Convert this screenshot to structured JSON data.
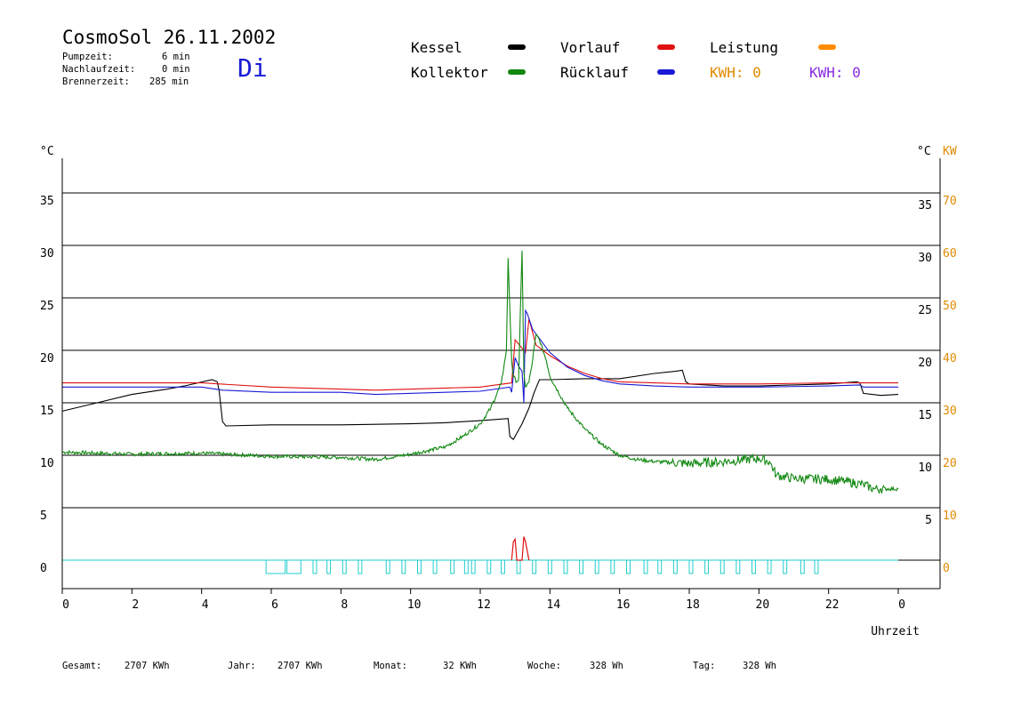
{
  "header": {
    "title": "CosmoSol 26.11.2002",
    "pumpzeit_label": "Pumpzeit:",
    "pumpzeit_value": "6 min",
    "nachlauf_label": "Nachlaufzeit:",
    "nachlauf_value": "0 min",
    "brenner_label": "Brennerzeit:",
    "brenner_value": "285 min",
    "day": "Di"
  },
  "legend": {
    "kessel": {
      "label": "Kessel",
      "color": "#000000"
    },
    "vorlauf": {
      "label": "Vorlauf",
      "color": "#e01010"
    },
    "leistung": {
      "label": "Leistung",
      "color": "#ff8c00"
    },
    "kollektor": {
      "label": "Kollektor",
      "color": "#118811"
    },
    "ruecklauf": {
      "label": "Rücklauf",
      "color": "#1a1ad6"
    },
    "kwh1": {
      "label": "KWH: 0",
      "color": "#e08a00"
    },
    "kwh2": {
      "label": "KWH: 0",
      "color": "#8a2be2"
    }
  },
  "footer": {
    "gesamt_label": "Gesamt:",
    "gesamt_value": "2707 KWh",
    "jahr_label": "Jahr:",
    "jahr_value": "2707 KWh",
    "monat_label": "Monat:",
    "monat_value": "32 KWh",
    "woche_label": "Woche:",
    "woche_value": "328 Wh",
    "tag_label": "Tag:",
    "tag_value": "328 Wh"
  },
  "chart_data": {
    "type": "line",
    "xlabel": "Uhrzeit",
    "ylabel_left": "°C",
    "ylabel_right_c": "°C",
    "ylabel_right_kw": "KW",
    "x_ticks": [
      "0",
      "2",
      "4",
      "6",
      "8",
      "10",
      "12",
      "14",
      "16",
      "18",
      "20",
      "22",
      "0"
    ],
    "y_ticks": [
      0,
      5,
      10,
      15,
      20,
      25,
      30,
      35
    ],
    "y_ticks_kw": [
      0,
      10,
      20,
      30,
      40,
      50,
      60,
      70
    ],
    "xlim": [
      0,
      24
    ],
    "ylim": [
      -2.7,
      38.5
    ],
    "grid": "horizontal",
    "series": [
      {
        "name": "Kessel",
        "color": "#000000",
        "x": [
          0,
          1,
          2,
          3,
          3.5,
          4.3,
          4.45,
          4.5,
          4.6,
          4.7,
          6,
          8,
          10,
          11,
          12,
          12.8,
          12.85,
          12.95,
          13.2,
          13.4,
          13.55,
          13.7,
          14,
          15,
          16,
          17,
          17.6,
          17.8,
          17.9,
          18,
          19,
          20,
          21,
          22,
          22.8,
          22.9,
          23,
          23.5,
          24
        ],
        "y": [
          14.2,
          15.0,
          15.8,
          16.3,
          16.6,
          17.2,
          17.0,
          16.2,
          13.2,
          12.8,
          12.9,
          12.9,
          13.0,
          13.1,
          13.3,
          13.5,
          11.8,
          11.5,
          13.0,
          14.5,
          16.0,
          17.2,
          17.2,
          17.3,
          17.3,
          17.8,
          18.0,
          18.1,
          17.0,
          16.8,
          16.6,
          16.6,
          16.7,
          16.8,
          17.0,
          16.9,
          15.9,
          15.7,
          15.8
        ]
      },
      {
        "name": "Vorlauf",
        "color": "#e01010",
        "x": [
          0,
          4,
          6,
          9,
          12,
          12.9,
          13.0,
          13.3,
          13.4,
          13.6,
          14,
          14.5,
          15,
          15.5,
          16,
          17,
          18,
          20,
          22,
          24
        ],
        "y": [
          16.9,
          16.9,
          16.5,
          16.2,
          16.5,
          16.9,
          21.0,
          19.8,
          23.0,
          20.5,
          19.5,
          18.5,
          17.8,
          17.3,
          17.0,
          16.9,
          16.8,
          16.8,
          16.9,
          16.9
        ],
        "x_wiggle": "none"
      },
      {
        "name": "Rücklauf",
        "color": "#1a1ad6",
        "x": [
          0,
          4,
          4.6,
          6,
          8,
          9,
          12,
          12.85,
          12.9,
          13.0,
          13.1,
          13.2,
          13.25,
          13.3,
          13.35,
          13.5,
          14,
          14.5,
          15,
          15.5,
          16,
          17,
          18,
          20,
          22,
          22.9,
          23,
          24
        ],
        "y": [
          16.5,
          16.5,
          16.2,
          16.0,
          16.0,
          15.8,
          16.1,
          16.5,
          16.0,
          19.3,
          18.5,
          18.0,
          15.0,
          23.8,
          23.5,
          22.0,
          19.8,
          18.4,
          17.6,
          17.1,
          16.8,
          16.6,
          16.5,
          16.5,
          16.6,
          16.7,
          16.5,
          16.5
        ]
      },
      {
        "name": "Kollektor",
        "color": "#118811",
        "x": [
          0,
          2,
          4,
          6,
          8,
          9,
          10,
          11,
          11.5,
          12,
          12.3,
          12.6,
          12.75,
          12.8,
          12.9,
          12.95,
          13.05,
          13.1,
          13.2,
          13.25,
          13.3,
          13.4,
          13.5,
          13.6,
          13.7,
          13.9,
          14,
          14.5,
          15,
          15.5,
          16,
          16.5,
          17,
          18,
          19,
          20,
          20.3,
          20.5,
          21,
          22,
          22.5,
          23,
          23.3,
          23.5,
          24
        ],
        "y": [
          10.3,
          10.1,
          10.2,
          9.9,
          9.8,
          9.6,
          10.1,
          10.8,
          11.8,
          13.0,
          14.5,
          16.8,
          20.0,
          28.8,
          19.0,
          17.5,
          17.0,
          17.2,
          29.5,
          18.0,
          16.5,
          17.0,
          19.0,
          21.5,
          21.0,
          19.0,
          17.5,
          14.5,
          12.5,
          11.0,
          10.0,
          9.6,
          9.4,
          9.2,
          9.4,
          9.7,
          9.4,
          8.1,
          7.8,
          7.7,
          7.5,
          7.2,
          6.8,
          6.8,
          6.8
        ]
      }
    ],
    "leistung_bars": {
      "color": "#e01010",
      "x": [
        12.9,
        12.95,
        13.0,
        13.05,
        13.2,
        13.25,
        13.3,
        13.4
      ],
      "y_kw": [
        0,
        3.5,
        4,
        0,
        0,
        4.5,
        3.5,
        0
      ]
    },
    "pump_on_intervals": [
      [
        5.85,
        6.4
      ],
      [
        6.45,
        6.85
      ],
      [
        7.2,
        7.3
      ],
      [
        7.6,
        7.7
      ],
      [
        8.05,
        8.15
      ],
      [
        8.5,
        8.6
      ],
      [
        9.3,
        9.4
      ],
      [
        9.75,
        9.85
      ],
      [
        10.2,
        10.3
      ],
      [
        10.65,
        10.75
      ],
      [
        11.15,
        11.25
      ],
      [
        11.55,
        11.65
      ],
      [
        11.75,
        11.85
      ],
      [
        12.2,
        12.3
      ],
      [
        12.6,
        12.7
      ],
      [
        13.05,
        13.15
      ],
      [
        13.5,
        13.6
      ],
      [
        13.95,
        14.05
      ],
      [
        14.4,
        14.5
      ],
      [
        14.85,
        14.95
      ],
      [
        15.3,
        15.4
      ],
      [
        15.75,
        15.85
      ],
      [
        16.2,
        16.3
      ],
      [
        16.7,
        16.8
      ],
      [
        17.1,
        17.2
      ],
      [
        17.55,
        17.65
      ],
      [
        18.0,
        18.1
      ],
      [
        18.45,
        18.55
      ],
      [
        18.9,
        19.0
      ],
      [
        19.35,
        19.45
      ],
      [
        19.8,
        19.9
      ],
      [
        20.25,
        20.35
      ],
      [
        20.7,
        20.8
      ],
      [
        21.2,
        21.3
      ],
      [
        21.6,
        21.7
      ]
    ],
    "pump_color": "#22cccc"
  }
}
